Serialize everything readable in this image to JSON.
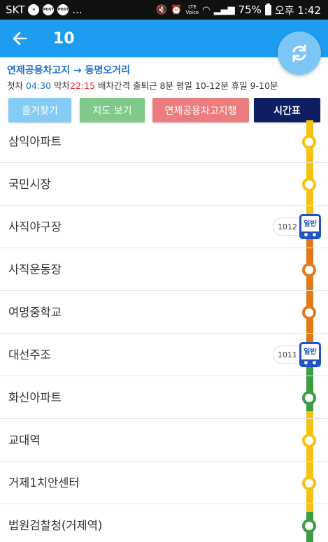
{
  "status": {
    "carrier": "SKT",
    "dots": "...",
    "post1": "POST",
    "post2": "POST",
    "lte": "LTE",
    "voice": "Voice",
    "battery": "75%",
    "time": "오후 1:42"
  },
  "header": {
    "route_number": "10"
  },
  "info": {
    "direction": "연제공용차고지 → 동명오거리",
    "first_label": "첫차",
    "first_time": "04:30",
    "last_label": "막차",
    "last_time": "22:15",
    "interval": "배차간격 출퇴근 8분 평일 10-12분 휴일 9-10분"
  },
  "buttons": {
    "favorite": "즐겨찾기",
    "map": "지도 보기",
    "destination": "연제공용차고지행",
    "timetable": "시간표"
  },
  "stops": [
    {
      "name": "삼익아파트"
    },
    {
      "name": "국민시장"
    },
    {
      "name": "사직야구장"
    },
    {
      "name": "사직운동장"
    },
    {
      "name": "여명중학교"
    },
    {
      "name": "대선주조"
    },
    {
      "name": "화신아파트"
    },
    {
      "name": "교대역"
    },
    {
      "name": "거제1치안센터"
    },
    {
      "name": "법원검찰청(거제역)"
    }
  ],
  "buses": [
    {
      "number": "1012",
      "type": "일반"
    },
    {
      "number": "1011",
      "type": "일반"
    }
  ],
  "colors": {
    "app_bar": "#1e9cf0",
    "yellow": "#f5c211",
    "orange": "#e07b1a",
    "green": "#3e9c45",
    "bus_blue": "#1f52c9"
  }
}
